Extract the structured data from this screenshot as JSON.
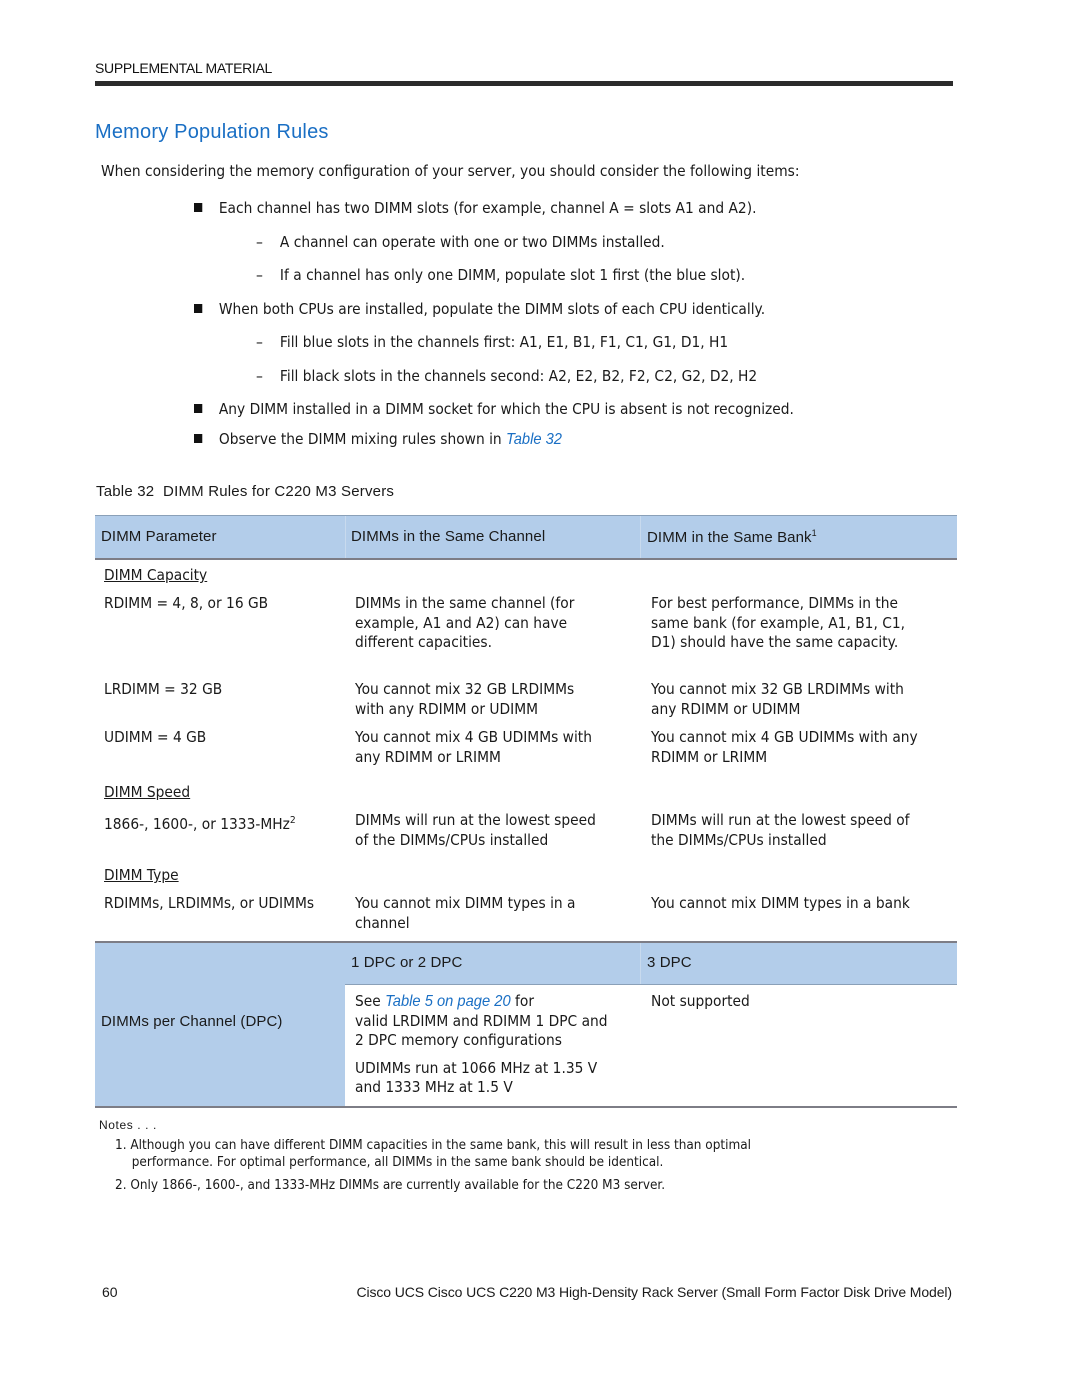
{
  "header": {
    "running_head": "SUPPLEMENTAL MATERIAL"
  },
  "section": {
    "title": "Memory Population Rules",
    "intro": "When considering the memory configuration of your server, you should consider the following items:"
  },
  "bullets": [
    {
      "text": "Each channel has two DIMM slots (for example, channel A = slots A1 and A2).",
      "subitems": [
        "A channel can operate with one or two DIMMs installed.",
        "If a channel has only one DIMM, populate slot 1 first (the blue slot)."
      ]
    },
    {
      "text": "When both CPUs are installed, populate the DIMM slots of each CPU identically.",
      "subitems": [
        "Fill blue slots in the channels first: A1, E1, B1, F1, C1, G1, D1, H1",
        "Fill black slots in the channels second: A2, E2, B2, F2, C2, G2, D2, H2"
      ]
    },
    {
      "text": "Any DIMM installed in a DIMM socket for which the CPU is absent is not recognized.",
      "subitems": []
    },
    {
      "text_prefix": "Observe the DIMM mixing rules shown in ",
      "link": "Table 32",
      "subitems": []
    }
  ],
  "table": {
    "caption": "Table 32  DIMM Rules for C220 M3 Servers",
    "headers": [
      "DIMM Parameter",
      "DIMMs in the Same Channel",
      "DIMM in the Same Bank"
    ],
    "header_footnote": "1",
    "groups": [
      {
        "label": "DIMM Capacity",
        "rows": [
          {
            "param": "RDIMM = 4, 8, or 16 GB",
            "channel": [
              "DIMMs in the same channel (for",
              "example, A1 and A2) can have",
              "different capacities."
            ],
            "bank": [
              "For best performance, DIMMs in the",
              "same bank (for example, A1, B1, C1,",
              "D1) should have the same capacity."
            ]
          },
          {
            "param": "LRDIMM = 32 GB",
            "channel": [
              "You cannot mix 32 GB LRDIMMs",
              "with any RDIMM or UDIMM"
            ],
            "bank": [
              "You cannot mix 32 GB LRDIMMs with",
              "any RDIMM or UDIMM"
            ]
          },
          {
            "param": "UDIMM = 4 GB",
            "channel": [
              "You cannot mix 4 GB UDIMMs with",
              "any RDIMM or LRIMM"
            ],
            "bank": [
              "You cannot mix 4 GB UDIMMs with any",
              "RDIMM or LRIMM"
            ]
          }
        ]
      },
      {
        "label": "DIMM Speed",
        "rows": [
          {
            "param": "1866-, 1600-, or 1333-MHz",
            "param_footnote": "2",
            "channel": [
              "DIMMs will run at the lowest speed",
              "of the DIMMs/CPUs installed"
            ],
            "bank": [
              "DIMMs will run at the lowest speed of",
              "the DIMMs/CPUs installed"
            ]
          }
        ]
      },
      {
        "label": "DIMM Type",
        "rows": [
          {
            "param": "RDIMMs, LRDIMMs, or UDIMMs",
            "channel": [
              "You cannot mix DIMM types in a",
              "channel"
            ],
            "bank": [
              "You cannot mix DIMM types in a bank"
            ]
          }
        ]
      }
    ],
    "dpc": {
      "label": "DIMMs per Channel (DPC)",
      "subheaders": [
        "1 DPC or 2 DPC",
        "3 DPC"
      ],
      "col1_see": "See ",
      "col1_link": "Table 5 on page 20",
      "col1_after_link": " for",
      "col1_lines": [
        "valid LRDIMM and RDIMM 1 DPC and",
        "2 DPC memory configurations"
      ],
      "col1_udimm": [
        "UDIMMs run at 1066 MHz at 1.35 V",
        "and 1333 MHz at 1.5 V"
      ],
      "col2": "Not supported"
    }
  },
  "notes": {
    "label": "Notes . . .",
    "items": [
      [
        "1. Although you can have different DIMM capacities in the same bank, this will result in less than optimal",
        "performance. For optimal performance, all DIMMs in the same bank should be identical."
      ],
      [
        "2. Only 1866-, 1600-, and 1333-MHz DIMMs are currently available for the C220 M3 server."
      ]
    ]
  },
  "footer": {
    "page_number": "60",
    "doc_title": "Cisco UCS Cisco UCS C220 M3 High-Density Rack Server (Small Form Factor Disk Drive Model)"
  }
}
